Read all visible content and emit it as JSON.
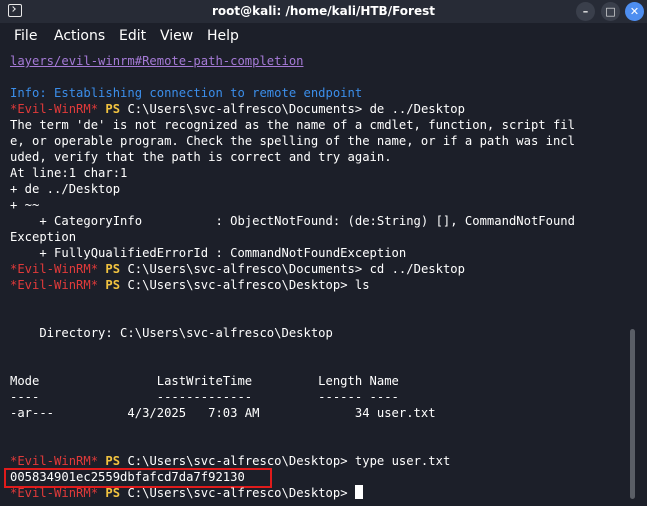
{
  "window": {
    "title": "root@kali: /home/kali/HTB/Forest",
    "minimize_glyph": "–",
    "maximize_glyph": "□",
    "close_glyph": "✕",
    "icon": "terminal-icon"
  },
  "menu": {
    "file": "File",
    "actions": "Actions",
    "edit": "Edit",
    "view": "View",
    "help": "Help"
  },
  "terminal": {
    "link_line": "layers/evil-winrm#Remote-path-completion",
    "info_line": "Info: Establishing connection to remote endpoint",
    "prompt_prefix": "*Evil-WinRM*",
    "ps": "PS",
    "cmd1_path": "C:\\Users\\svc-alfresco\\Documents>",
    "cmd1": " de ../Desktop",
    "err1": "The term 'de' is not recognized as the name of a cmdlet, function, script fil",
    "err2": "e, or operable program. Check the spelling of the name, or if a path was incl",
    "err3": "uded, verify that the path is correct and try again.",
    "err4": "At line:1 char:1",
    "err5": "+ de ../Desktop",
    "err6": "+ ~~",
    "err7": "    + CategoryInfo          : ObjectNotFound: (de:String) [], CommandNotFound",
    "err8": "Exception",
    "err9": "    + FullyQualifiedErrorId : CommandNotFoundException",
    "cmd2_path": "C:\\Users\\svc-alfresco\\Documents>",
    "cmd2": " cd ../Desktop",
    "cmd3_path": "C:\\Users\\svc-alfresco\\Desktop>",
    "cmd3": " ls",
    "dir_line": "    Directory: C:\\Users\\svc-alfresco\\Desktop",
    "header_line": "Mode                LastWriteTime         Length Name",
    "underline_line": "----                -------------         ------ ----",
    "row_line": "-ar---          4/3/2025   7:03 AM             34 user.txt",
    "cmd4_path": "C:\\Users\\svc-alfresco\\Desktop>",
    "cmd4": " type user.txt",
    "flag": "005834901ec2559dbfafcd7da7f92130",
    "cmd5_path": "C:\\Users\\svc-alfresco\\Desktop>"
  },
  "colors": {
    "background": "#1c1f29",
    "prompt_red": "#e03a3a",
    "ps_yellow": "#f2c340",
    "info_blue": "#3b8eea",
    "highlight_red": "#e01b1b"
  }
}
